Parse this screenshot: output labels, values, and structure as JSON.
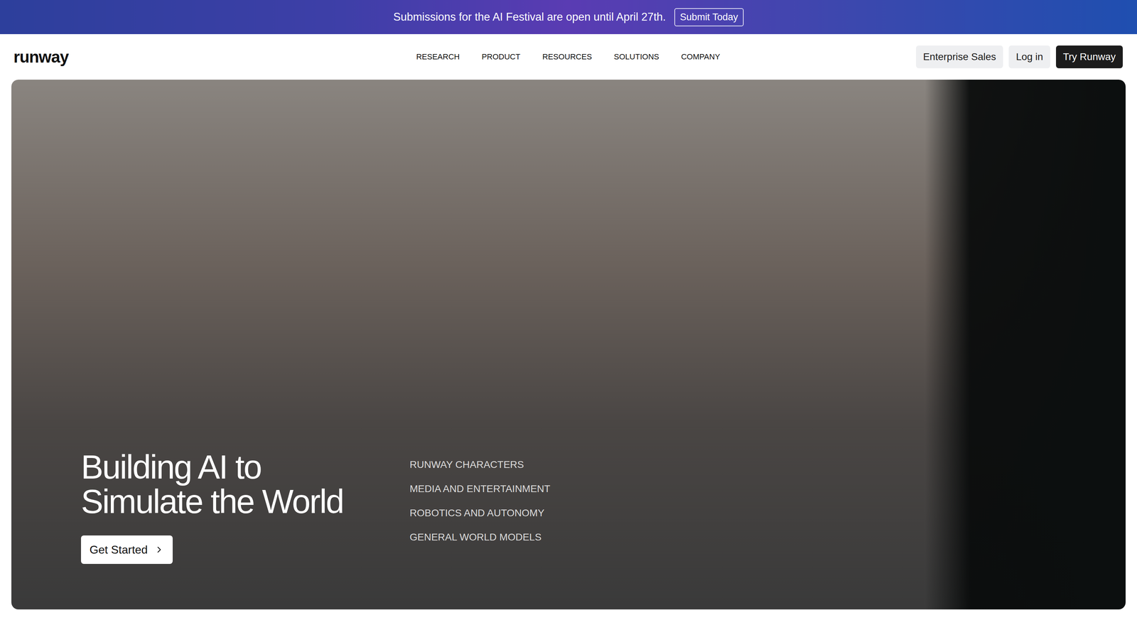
{
  "banner": {
    "text": "Submissions for the AI Festival are open until April 27th.",
    "button": "Submit Today"
  },
  "nav": {
    "logo": "runway",
    "links": [
      "RESEARCH",
      "PRODUCT",
      "RESOURCES",
      "SOLUTIONS",
      "COMPANY"
    ],
    "actions": [
      {
        "label": "Enterprise Sales",
        "kind": "secondary"
      },
      {
        "label": "Log in",
        "kind": "secondary"
      },
      {
        "label": "Try Runway",
        "kind": "primary"
      }
    ]
  },
  "hero": {
    "title_lines": [
      "Building AI to",
      "Simulate the World"
    ],
    "cta": "Get Started",
    "categories": [
      "RUNWAY CHARACTERS",
      "MEDIA AND ENTERTAINMENT",
      "ROBOTICS AND AUTONOMY",
      "GENERAL WORLD MODELS"
    ]
  }
}
